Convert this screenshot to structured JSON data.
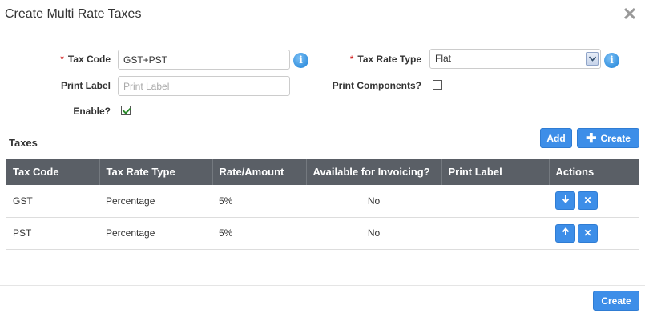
{
  "dialog": {
    "title": "Create Multi Rate Taxes"
  },
  "form": {
    "tax_code_label": "Tax Code",
    "tax_code_value": "GST+PST",
    "print_label_label": "Print Label",
    "print_label_placeholder": "Print Label",
    "enable_label": "Enable?",
    "enable_checked": true,
    "tax_rate_type_label": "Tax Rate Type",
    "tax_rate_type_value": "Flat",
    "print_components_label": "Print Components?",
    "print_components_checked": false,
    "required_marker": "*",
    "info_glyph": "i"
  },
  "taxes": {
    "title": "Taxes",
    "add_label": "Add",
    "create_label": "Create",
    "columns": [
      "Tax Code",
      "Tax Rate Type",
      "Rate/Amount",
      "Available for Invoicing?",
      "Print Label",
      "Actions"
    ],
    "rows": [
      {
        "tax_code": "GST",
        "tax_rate_type": "Percentage",
        "rate": "5%",
        "available": "No",
        "print_label": ""
      },
      {
        "tax_code": "PST",
        "tax_rate_type": "Percentage",
        "rate": "5%",
        "available": "No",
        "print_label": ""
      }
    ]
  },
  "footer": {
    "create_label": "Create"
  },
  "colors": {
    "accent": "#3d8ee8",
    "header": "#5a5f66",
    "required": "#c00"
  }
}
